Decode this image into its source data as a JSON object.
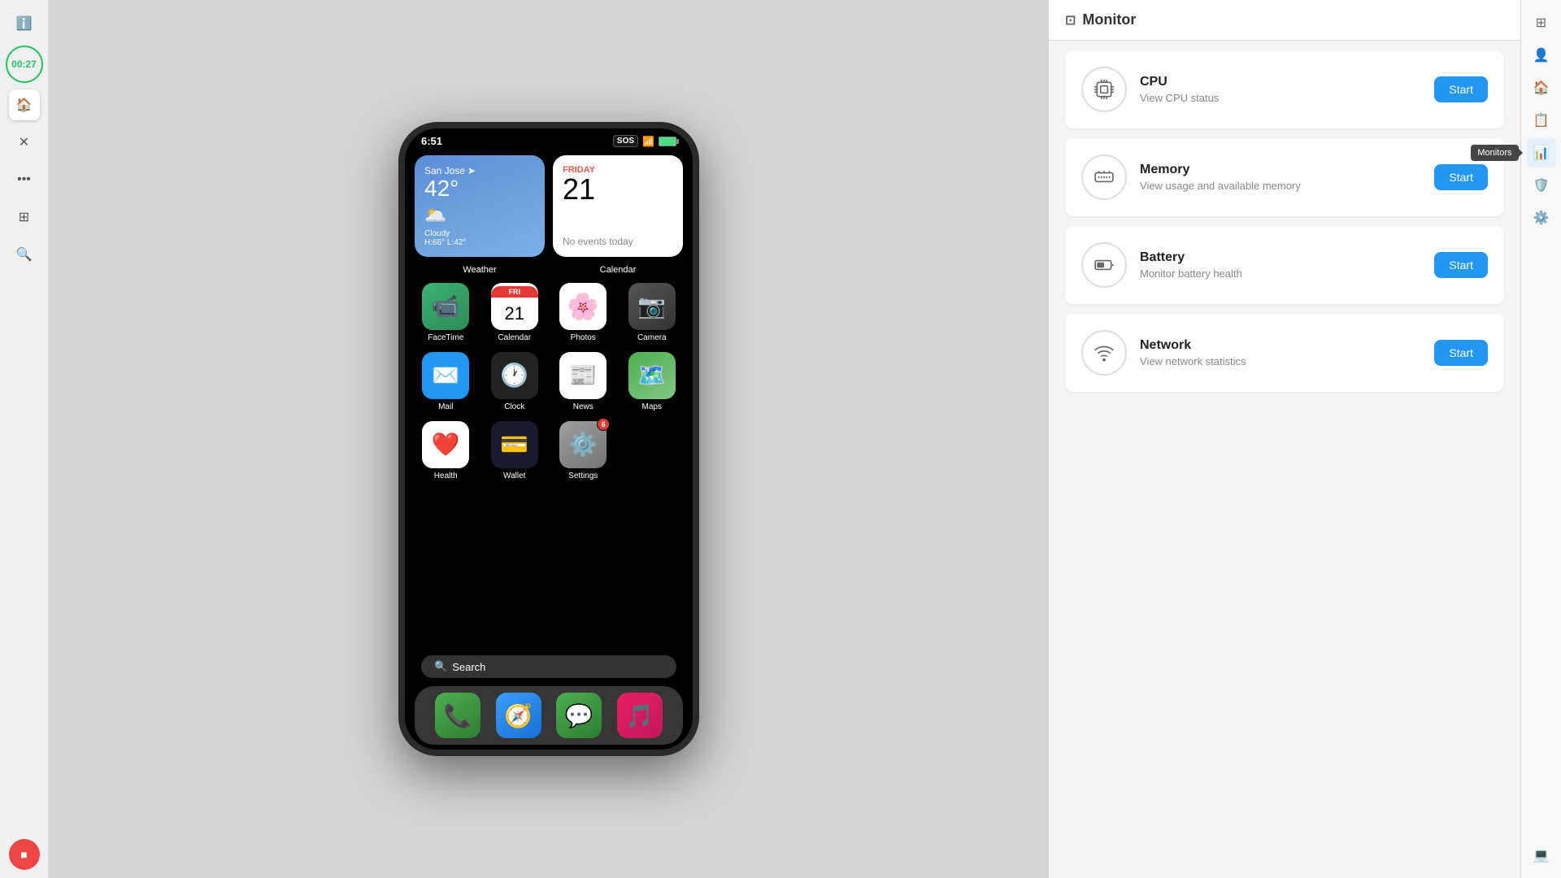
{
  "leftToolbar": {
    "timer": "00:27",
    "icons": [
      "info",
      "home",
      "close",
      "more",
      "layers",
      "search",
      "display"
    ],
    "stop": "■"
  },
  "phone": {
    "statusBar": {
      "time": "6:51",
      "sos": "SOS",
      "battery": "85%"
    },
    "widgets": {
      "weather": {
        "city": "San Jose",
        "temp": "42°",
        "condition": "Cloudy",
        "high": "H:66°",
        "low": "L:42°",
        "label": "Weather"
      },
      "calendar": {
        "dayName": "FRIDAY",
        "date": "21",
        "noEvents": "No events today",
        "label": "Calendar"
      }
    },
    "apps": [
      {
        "name": "FaceTime",
        "icon": "📹",
        "bg": "facetime-icon"
      },
      {
        "name": "Calendar",
        "icon": "cal",
        "bg": "calendar-icon",
        "calDay": "FRI",
        "calDate": "21"
      },
      {
        "name": "Photos",
        "icon": "🌈",
        "bg": "photos-icon"
      },
      {
        "name": "Camera",
        "icon": "📷",
        "bg": "camera-icon"
      },
      {
        "name": "Mail",
        "icon": "✉️",
        "bg": "mail-icon"
      },
      {
        "name": "Clock",
        "icon": "🕐",
        "bg": "clock-icon"
      },
      {
        "name": "News",
        "icon": "📰",
        "bg": "news-icon"
      },
      {
        "name": "Maps",
        "icon": "🗺️",
        "bg": "maps-icon"
      },
      {
        "name": "Health",
        "icon": "❤️",
        "bg": "health-icon"
      },
      {
        "name": "Wallet",
        "icon": "💳",
        "bg": "wallet-icon"
      },
      {
        "name": "Settings",
        "icon": "⚙️",
        "bg": "settings-icon",
        "badge": "6"
      }
    ],
    "search": "Search",
    "dock": [
      {
        "name": "Phone",
        "icon": "📞",
        "bg": "phone-dock"
      },
      {
        "name": "Safari",
        "icon": "🧭",
        "bg": "safari-dock"
      },
      {
        "name": "Messages",
        "icon": "💬",
        "bg": "messages-dock"
      },
      {
        "name": "Music",
        "icon": "🎵",
        "bg": "music-dock"
      }
    ]
  },
  "monitor": {
    "title": "Monitor",
    "items": [
      {
        "id": "cpu",
        "title": "CPU",
        "description": "View CPU status",
        "icon": "cpu",
        "buttonLabel": "Start"
      },
      {
        "id": "memory",
        "title": "Memory",
        "description": "View usage and available memory",
        "icon": "memory",
        "buttonLabel": "Start"
      },
      {
        "id": "battery",
        "title": "Battery",
        "description": "Monitor battery health",
        "icon": "battery",
        "buttonLabel": "Start"
      },
      {
        "id": "network",
        "title": "Network",
        "description": "View network statistics",
        "icon": "network",
        "buttonLabel": "Start"
      }
    ]
  },
  "rightBar": {
    "icons": [
      "grid",
      "profile",
      "home2",
      "register",
      "search2",
      "chart",
      "shield",
      "tooltip-monitors"
    ],
    "tooltipText": "Monitors"
  }
}
